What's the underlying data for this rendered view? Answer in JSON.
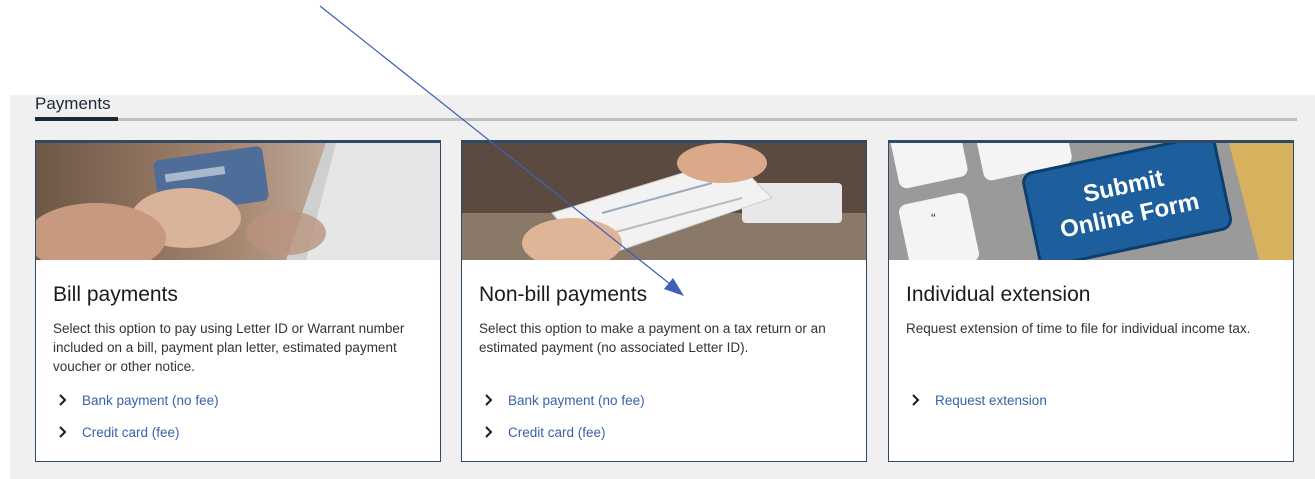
{
  "section": {
    "title": "Payments"
  },
  "cards": [
    {
      "title": "Bill payments",
      "description": "Select this option to pay using Letter ID or Warrant number included on a bill, payment plan letter, estimated payment voucher or other notice.",
      "links": [
        "Bank payment (no fee)",
        "Credit card (fee)"
      ]
    },
    {
      "title": "Non-bill payments",
      "description": "Select this option to make a payment on a tax return or an estimated payment (no associated Letter ID).",
      "links": [
        "Bank payment (no fee)",
        "Credit card (fee)"
      ]
    },
    {
      "title": "Individual extension",
      "description": "Request extension of time to file for individual income tax.",
      "links": [
        "Request extension"
      ],
      "image_text": [
        "Submit",
        "Online Form"
      ]
    }
  ],
  "colors": {
    "accent": "#2f4a66",
    "link": "#3a62a8",
    "annotation": "#3f5fb8",
    "panel": "#f0f0f0"
  }
}
